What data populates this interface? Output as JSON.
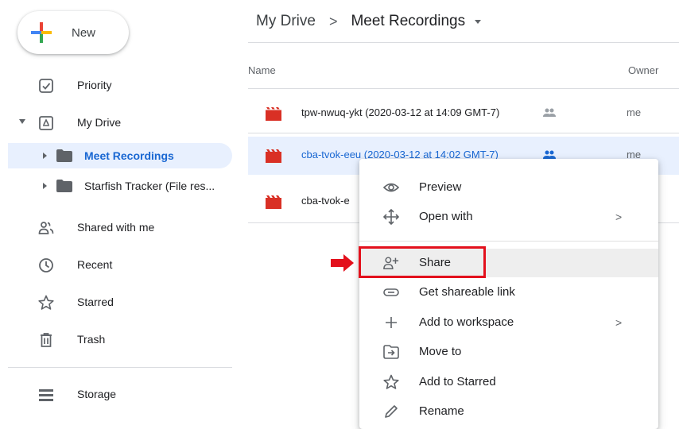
{
  "sidebar": {
    "new_label": "New",
    "items": [
      {
        "label": "Priority",
        "icon": "priority-icon"
      },
      {
        "label": "My Drive",
        "icon": "my-drive-icon"
      },
      {
        "label": "Shared with me",
        "icon": "shared-icon"
      },
      {
        "label": "Recent",
        "icon": "clock-icon"
      },
      {
        "label": "Starred",
        "icon": "star-icon"
      },
      {
        "label": "Trash",
        "icon": "trash-icon"
      },
      {
        "label": "Storage",
        "icon": "storage-icon"
      }
    ],
    "tree": [
      {
        "label": "Meet Recordings",
        "selected": true
      },
      {
        "label": "Starfish Tracker (File res...",
        "selected": false
      }
    ]
  },
  "breadcrumb": {
    "root": "My Drive",
    "separator": ">",
    "current": "Meet Recordings"
  },
  "table": {
    "columns": [
      "Name",
      "Owner"
    ],
    "rows": [
      {
        "name": "tpw-nwuq-ykt (2020-03-12 at 14:09 GMT-7)",
        "owner": "me",
        "shared": true,
        "selected": false
      },
      {
        "name": "cba-tvok-eeu (2020-03-12 at 14:02 GMT-7)",
        "owner": "me",
        "shared": true,
        "selected": true
      },
      {
        "name": "cba-tvok-e",
        "owner": "",
        "shared": false,
        "selected": false
      }
    ]
  },
  "context_menu": {
    "items": [
      {
        "label": "Preview",
        "icon": "eye-icon",
        "submenu": false
      },
      {
        "label": "Open with",
        "icon": "open-with-icon",
        "submenu": true
      },
      {
        "label": "Share",
        "icon": "add-person-icon",
        "submenu": false,
        "highlighted": true
      },
      {
        "label": "Get shareable link",
        "icon": "link-icon",
        "submenu": false
      },
      {
        "label": "Add to workspace",
        "icon": "plus-icon",
        "submenu": true
      },
      {
        "label": "Move to",
        "icon": "move-to-icon",
        "submenu": false
      },
      {
        "label": "Add to Starred",
        "icon": "star-icon",
        "submenu": false
      },
      {
        "label": "Rename",
        "icon": "pencil-icon",
        "submenu": false
      }
    ],
    "submenu_glyph": ">"
  },
  "colors": {
    "selection_bg": "#e8f0fe",
    "selection_text": "#1967d2",
    "video_icon": "#d93025",
    "highlight_red": "#e3101c"
  }
}
